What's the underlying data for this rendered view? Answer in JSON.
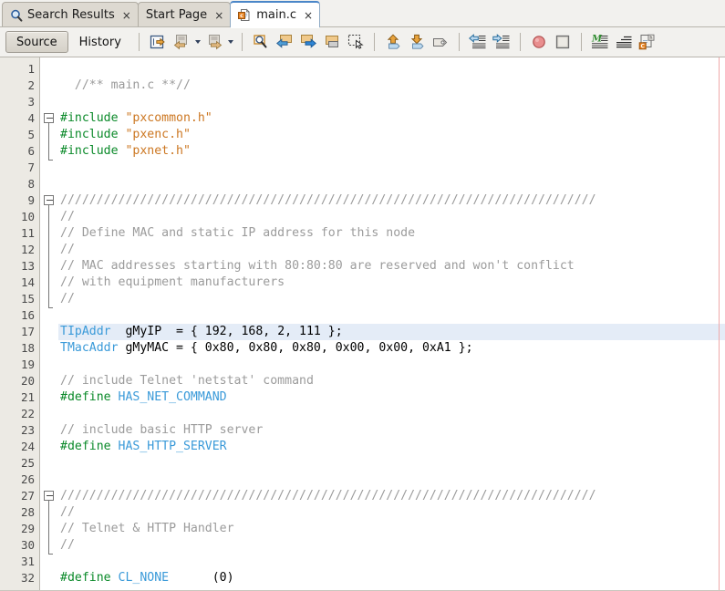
{
  "window": {
    "title": "main.c"
  },
  "tabs": [
    {
      "label": "Search Results",
      "icon": "search-icon",
      "close": "×",
      "active": false
    },
    {
      "label": "Start Page",
      "icon": "none",
      "close": "×",
      "active": false
    },
    {
      "label": "main.c",
      "icon": "c-file-icon",
      "close": "×",
      "active": true
    }
  ],
  "toolbar": {
    "source_label": "Source",
    "history_label": "History",
    "buttons": [
      {
        "name": "last-edit-button",
        "icon": "last-edit-icon"
      },
      {
        "name": "back-button",
        "icon": "back-arrow-icon"
      },
      {
        "name": "back-dropdown",
        "icon": "chevron-down-icon"
      },
      {
        "name": "forward-button",
        "icon": "forward-arrow-icon"
      },
      {
        "name": "forward-dropdown",
        "icon": "chevron-down-icon"
      },
      {
        "name": "find-selection-button",
        "icon": "magnifier-icon"
      },
      {
        "name": "shift-left-button",
        "icon": "blue-left-arrow-icon"
      },
      {
        "name": "shift-right-button",
        "icon": "blue-right-arrow-icon"
      },
      {
        "name": "comment-button",
        "icon": "window-icon"
      },
      {
        "name": "select-rectangle-button",
        "icon": "dotted-rect-icon"
      },
      {
        "name": "previous-bookmark-button",
        "icon": "up-arrow-icon"
      },
      {
        "name": "next-bookmark-button",
        "icon": "down-arrow-icon"
      },
      {
        "name": "toggle-bookmark-button",
        "icon": "tag-icon"
      },
      {
        "name": "shift-line-left-button",
        "icon": "shift-left-lines-icon"
      },
      {
        "name": "shift-line-right-button",
        "icon": "shift-right-lines-icon"
      },
      {
        "name": "toggle-breakpoint-button",
        "icon": "red-circle-icon"
      },
      {
        "name": "stop-button",
        "icon": "stop-square-icon"
      },
      {
        "name": "toggle-highlight-button",
        "icon": "green-highlight-icon"
      },
      {
        "name": "toggle-rect-select-button",
        "icon": "lines-icon"
      },
      {
        "name": "inspect-members-button",
        "icon": "c-inspect-icon"
      }
    ]
  },
  "editor": {
    "highlighted_line": 17,
    "total_visible_lines": 32,
    "lines": [
      {
        "n": 1,
        "tokens": []
      },
      {
        "n": 2,
        "tokens": [
          {
            "t": "cm",
            "s": "  //** main.c **//"
          }
        ]
      },
      {
        "n": 3,
        "tokens": []
      },
      {
        "n": 4,
        "tokens": [
          {
            "t": "kw",
            "s": "#include "
          },
          {
            "t": "str",
            "s": "\"pxcommon.h\""
          }
        ],
        "fold": "start"
      },
      {
        "n": 5,
        "tokens": [
          {
            "t": "kw",
            "s": "#include "
          },
          {
            "t": "str",
            "s": "\"pxenc.h\""
          }
        ],
        "fold": "mid"
      },
      {
        "n": 6,
        "tokens": [
          {
            "t": "kw",
            "s": "#include "
          },
          {
            "t": "str",
            "s": "\"pxnet.h\""
          }
        ],
        "fold": "end"
      },
      {
        "n": 7,
        "tokens": []
      },
      {
        "n": 8,
        "tokens": []
      },
      {
        "n": 9,
        "tokens": [
          {
            "t": "cm",
            "s": "//////////////////////////////////////////////////////////////////////////"
          }
        ],
        "fold": "start"
      },
      {
        "n": 10,
        "tokens": [
          {
            "t": "cm",
            "s": "//"
          }
        ],
        "fold": "mid"
      },
      {
        "n": 11,
        "tokens": [
          {
            "t": "cm",
            "s": "// Define MAC and static IP address for this node"
          }
        ],
        "fold": "mid"
      },
      {
        "n": 12,
        "tokens": [
          {
            "t": "cm",
            "s": "//"
          }
        ],
        "fold": "mid"
      },
      {
        "n": 13,
        "tokens": [
          {
            "t": "cm",
            "s": "// MAC addresses starting with 80:80:80 are reserved and won't conflict"
          }
        ],
        "fold": "mid"
      },
      {
        "n": 14,
        "tokens": [
          {
            "t": "cm",
            "s": "// with equipment manufacturers"
          }
        ],
        "fold": "mid"
      },
      {
        "n": 15,
        "tokens": [
          {
            "t": "cm",
            "s": "//"
          }
        ],
        "fold": "end"
      },
      {
        "n": 16,
        "tokens": []
      },
      {
        "n": 17,
        "tokens": [
          {
            "t": "ty",
            "s": "TIpAddr"
          },
          {
            "t": "pl",
            "s": "  gMyIP  = { 192, 168, 2, 111 };"
          }
        ]
      },
      {
        "n": 18,
        "tokens": [
          {
            "t": "ty",
            "s": "TMacAddr"
          },
          {
            "t": "pl",
            "s": " gMyMAC = { 0x80, 0x80, 0x80, 0x00, 0x00, 0xA1 };"
          }
        ]
      },
      {
        "n": 19,
        "tokens": []
      },
      {
        "n": 20,
        "tokens": [
          {
            "t": "cm",
            "s": "// include Telnet 'netstat' command"
          }
        ]
      },
      {
        "n": 21,
        "tokens": [
          {
            "t": "kw",
            "s": "#define "
          },
          {
            "t": "mac",
            "s": "HAS_NET_COMMAND"
          }
        ]
      },
      {
        "n": 22,
        "tokens": []
      },
      {
        "n": 23,
        "tokens": [
          {
            "t": "cm",
            "s": "// include basic HTTP server"
          }
        ]
      },
      {
        "n": 24,
        "tokens": [
          {
            "t": "kw",
            "s": "#define "
          },
          {
            "t": "mac",
            "s": "HAS_HTTP_SERVER"
          }
        ]
      },
      {
        "n": 25,
        "tokens": []
      },
      {
        "n": 26,
        "tokens": []
      },
      {
        "n": 27,
        "tokens": [
          {
            "t": "cm",
            "s": "//////////////////////////////////////////////////////////////////////////"
          }
        ],
        "fold": "start"
      },
      {
        "n": 28,
        "tokens": [
          {
            "t": "cm",
            "s": "//"
          }
        ],
        "fold": "mid"
      },
      {
        "n": 29,
        "tokens": [
          {
            "t": "cm",
            "s": "// Telnet & HTTP Handler"
          }
        ],
        "fold": "mid"
      },
      {
        "n": 30,
        "tokens": [
          {
            "t": "cm",
            "s": "//"
          }
        ],
        "fold": "end"
      },
      {
        "n": 31,
        "tokens": []
      },
      {
        "n": 32,
        "tokens": [
          {
            "t": "kw",
            "s": "#define "
          },
          {
            "t": "mac",
            "s": "CL_NONE"
          },
          {
            "t": "pl",
            "s": "      (0)"
          }
        ]
      }
    ]
  },
  "colors": {
    "comment": "#9b9b9b",
    "keyword": "#0b8a2a",
    "string": "#cc7722",
    "type": "#3a9ad9",
    "macro": "#3a9ad9",
    "current_line_highlight": "#e4ecf7",
    "gutter_background": "#eceae4",
    "margin_guide": "#f0a9a9",
    "tab_active_border": "#4a86c8"
  }
}
